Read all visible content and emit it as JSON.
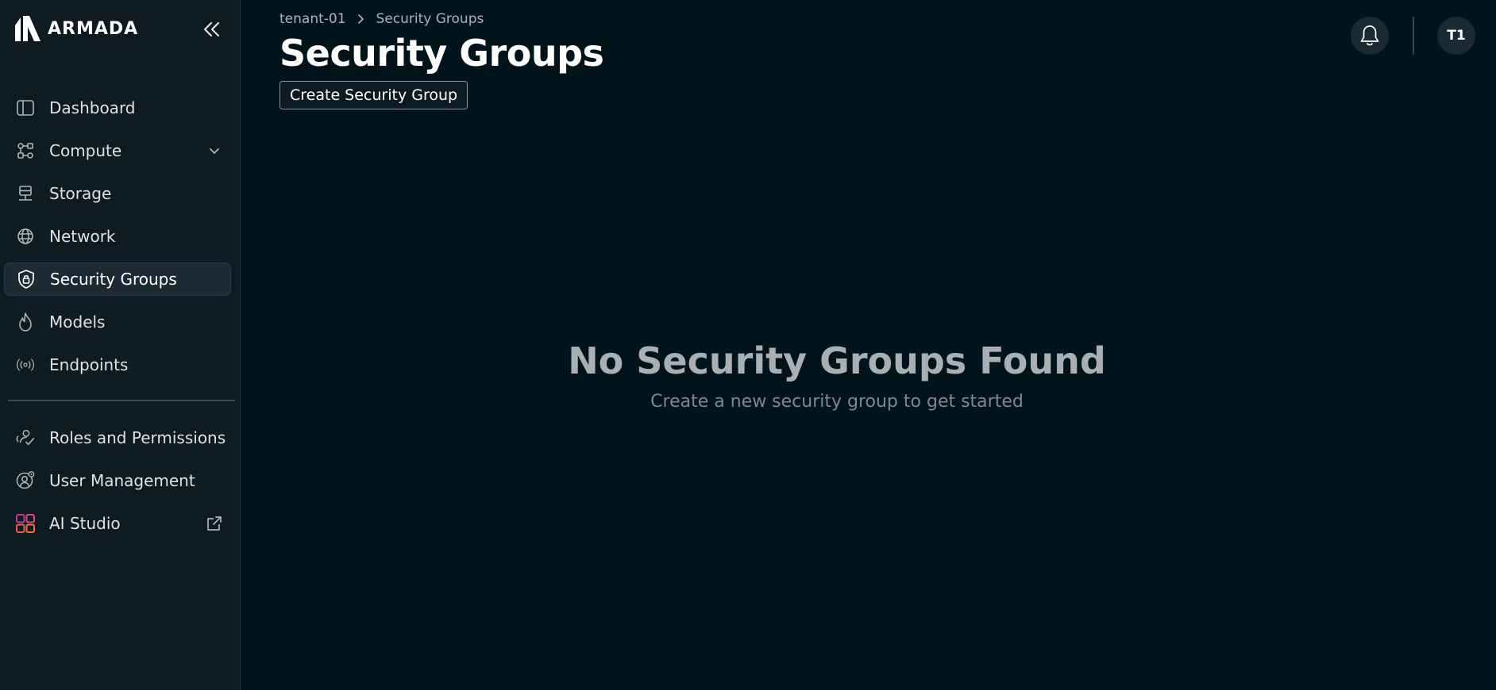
{
  "brand": {
    "name": "ARMADA"
  },
  "sidebar": {
    "collapse_icon": "double-chevron-left-icon",
    "items": [
      {
        "label": "Dashboard",
        "icon": "dashboard-icon"
      },
      {
        "label": "Compute",
        "icon": "compute-icon",
        "trailing": "chevron-down-icon"
      },
      {
        "label": "Storage",
        "icon": "storage-icon"
      },
      {
        "label": "Network",
        "icon": "globe-icon"
      },
      {
        "label": "Security Groups",
        "icon": "shield-lock-icon",
        "active": true
      },
      {
        "label": "Models",
        "icon": "flame-icon"
      },
      {
        "label": "Endpoints",
        "icon": "broadcast-icon"
      }
    ],
    "secondary_items": [
      {
        "label": "Roles and Permissions",
        "icon": "users-check-icon"
      },
      {
        "label": "User Management",
        "icon": "user-gear-icon"
      },
      {
        "label": "AI Studio",
        "icon": "ai-studio-icon",
        "trailing": "external-link-icon"
      }
    ]
  },
  "header": {
    "breadcrumb": [
      "tenant-01",
      "Security Groups"
    ],
    "title": "Security Groups",
    "create_button_label": "Create Security Group",
    "avatar_initials": "T1"
  },
  "empty_state": {
    "title": "No Security Groups Found",
    "subtitle": "Create a new security group to get started"
  },
  "colors": {
    "background": "#02141b",
    "sidebar": "#0f1b23",
    "active_item": "#1c2a33",
    "text": "#ffffff",
    "muted": "#a9b0b4"
  }
}
